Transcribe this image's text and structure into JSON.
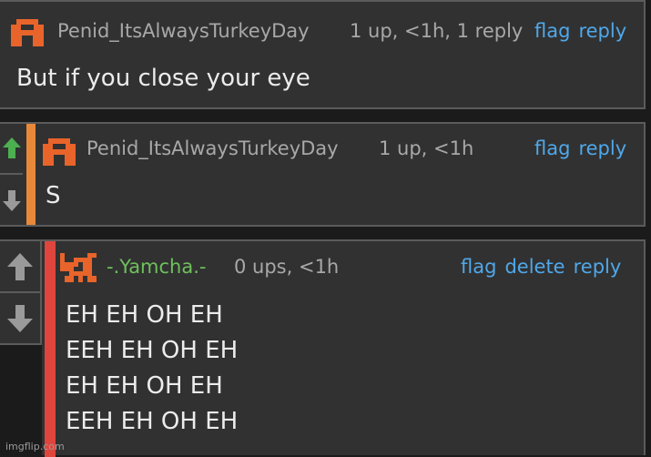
{
  "comments": [
    {
      "username": "Penid_ItsAlwaysTurkeyDay",
      "meta": "1 up, <1h, 1 reply",
      "actions": [
        "flag",
        "reply"
      ],
      "body": [
        "But if you close your eye"
      ]
    },
    {
      "username": "Penid_ItsAlwaysTurkeyDay",
      "meta": "1 up, <1h",
      "actions": [
        "flag",
        "reply"
      ],
      "body": [
        "S"
      ],
      "bar_color": "#e8893a"
    },
    {
      "username": "-.Yamcha.-",
      "meta": "0 ups, <1h",
      "actions": [
        "flag",
        "delete",
        "reply"
      ],
      "body": [
        "EH EH OH EH",
        "EEH EH OH EH",
        "EH EH OH EH",
        "EEH EH OH EH"
      ],
      "bar_color": "#e0453d"
    }
  ],
  "colors": {
    "link": "#4fa8ea",
    "upvote_active": "#4caf50",
    "username_self": "#6ec05d"
  },
  "icons": {
    "avatar_1": "orange-pixel-avatar-icon",
    "avatar_3": "pixel-fox-avatar-icon",
    "upvote": "up-arrow-icon",
    "downvote": "down-arrow-icon"
  },
  "watermark": "imgflip.com"
}
